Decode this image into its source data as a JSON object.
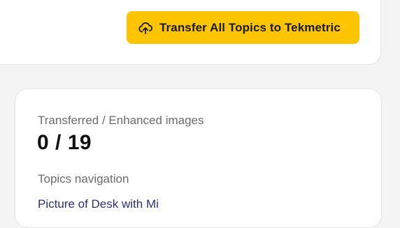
{
  "toolbar": {
    "transfer_button_label": "Transfer All Topics to Tekmetric",
    "transfer_icon": "cloud-upload-icon"
  },
  "stats": {
    "label": "Transferred / Enhanced images",
    "value": "0 / 19"
  },
  "navigation": {
    "label": "Topics navigation",
    "items": [
      {
        "label": "Picture of Desk with Mi"
      }
    ]
  },
  "colors": {
    "accent": "#fdc500",
    "background": "#f4f4f5",
    "card": "#ffffff",
    "link": "#2b2f7a"
  }
}
